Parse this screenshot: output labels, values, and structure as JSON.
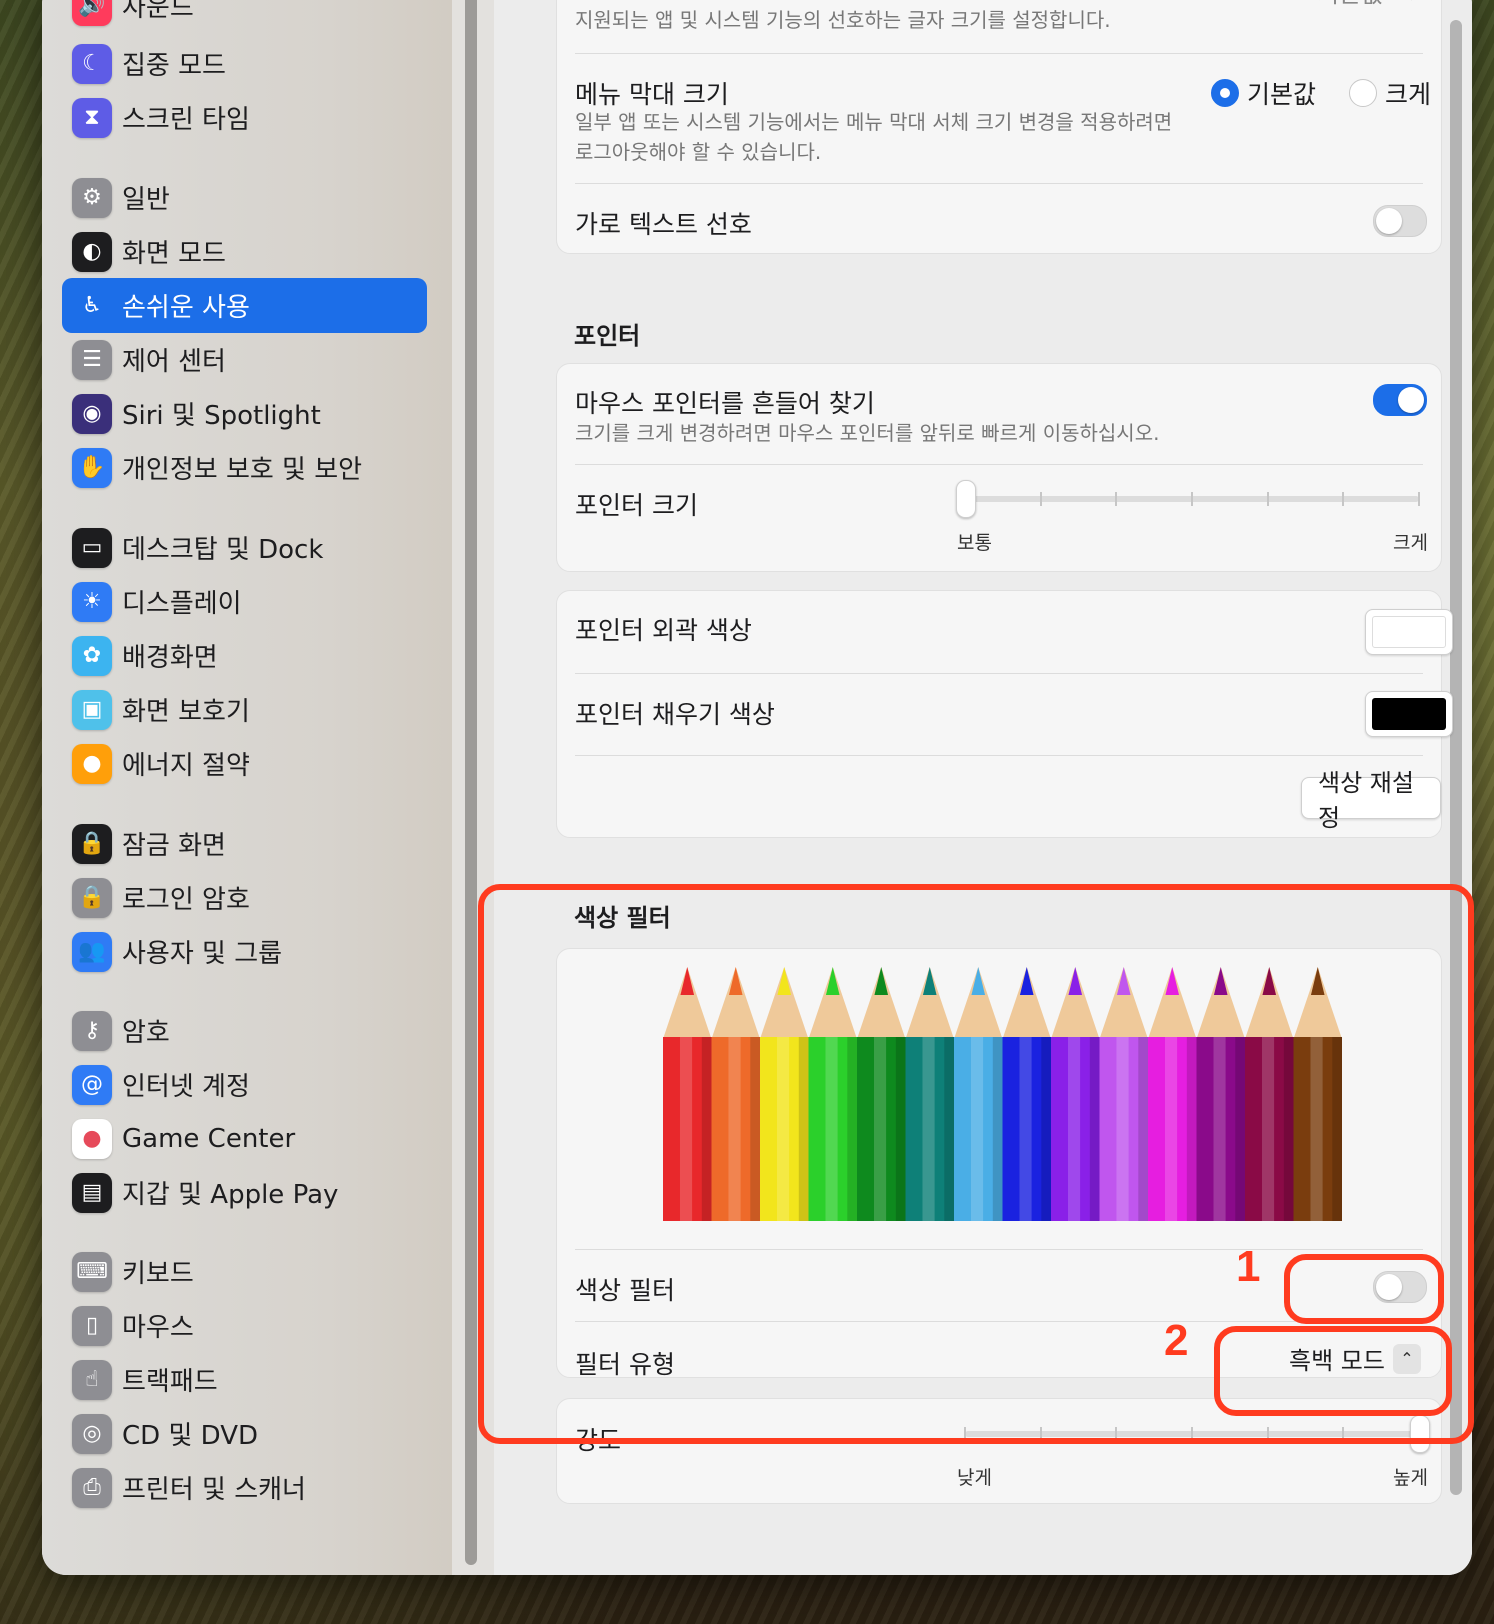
{
  "sidebar": {
    "items": [
      {
        "label": "사운드",
        "icon": "speaker-icon",
        "color": "#ff3b5c"
      },
      {
        "label": "집중 모드",
        "icon": "moon-icon",
        "color": "#5e5ce6"
      },
      {
        "label": "스크린 타임",
        "icon": "hourglass-icon",
        "color": "#5e5ce6"
      },
      {
        "label": "일반",
        "icon": "gear-icon",
        "color": "#8e8e93"
      },
      {
        "label": "화면 모드",
        "icon": "appearance-icon",
        "color": "#1d1d1f"
      },
      {
        "label": "손쉬운 사용",
        "icon": "accessibility-icon",
        "color": "#1c6ee8"
      },
      {
        "label": "제어 센터",
        "icon": "toggles-icon",
        "color": "#8e8e93"
      },
      {
        "label": "Siri 및 Spotlight",
        "icon": "siri-icon",
        "color": "#3a2f7a"
      },
      {
        "label": "개인정보 보호 및 보안",
        "icon": "hand-icon",
        "color": "#2f7bf5"
      },
      {
        "label": "데스크탑 및 Dock",
        "icon": "dock-icon",
        "color": "#1d1d1f"
      },
      {
        "label": "디스플레이",
        "icon": "brightness-icon",
        "color": "#2f7bf5"
      },
      {
        "label": "배경화면",
        "icon": "flower-icon",
        "color": "#3cb4f0"
      },
      {
        "label": "화면 보호기",
        "icon": "screensaver-icon",
        "color": "#4fc1ea"
      },
      {
        "label": "에너지 절약",
        "icon": "bulb-icon",
        "color": "#ff9f0a"
      },
      {
        "label": "잠금 화면",
        "icon": "lock-screen-icon",
        "color": "#1d1d1f"
      },
      {
        "label": "로그인 암호",
        "icon": "lock-icon",
        "color": "#8e8e93"
      },
      {
        "label": "사용자 및 그룹",
        "icon": "users-icon",
        "color": "#2f7bf5"
      },
      {
        "label": "암호",
        "icon": "key-icon",
        "color": "#8e8e93"
      },
      {
        "label": "인터넷 계정",
        "icon": "at-icon",
        "color": "#2f7bf5"
      },
      {
        "label": "Game Center",
        "icon": "game-center-icon",
        "color": "#ffffff"
      },
      {
        "label": "지갑 및 Apple Pay",
        "icon": "wallet-icon",
        "color": "#1d1d1f"
      },
      {
        "label": "키보드",
        "icon": "keyboard-icon",
        "color": "#8e8e93"
      },
      {
        "label": "마우스",
        "icon": "mouse-icon",
        "color": "#8e8e93"
      },
      {
        "label": "트랙패드",
        "icon": "trackpad-icon",
        "color": "#8e8e93"
      },
      {
        "label": "CD 및 DVD",
        "icon": "disc-icon",
        "color": "#8e8e93"
      },
      {
        "label": "프린터 및 스캐너",
        "icon": "printer-icon",
        "color": "#8e8e93"
      }
    ],
    "active_index": 5
  },
  "display": {
    "text_size_sub": "지원되는 앱 및 시스템 기능의 선호하는 글자 크기를 설정합니다.",
    "text_size_value": "기본값",
    "menubar_title": "메뉴 막대 크기",
    "menubar_sub1": "일부 앱 또는 시스템 기능에서는 메뉴 막대 서체 크기 변경을 적용하려면",
    "menubar_sub2": "로그아웃해야 할 수 있습니다.",
    "radio_default": "기본값",
    "radio_large": "크게",
    "horizontal_text": "가로 텍스트 선호"
  },
  "pointer": {
    "section_title": "포인터",
    "shake_title": "마우스 포인터를 흔들어 찾기",
    "shake_sub": "크기를 크게 변경하려면 마우스 포인터를 앞뒤로 빠르게 이동하십시오.",
    "shake_on": true,
    "size_title": "포인터 크기",
    "size_min": "보통",
    "size_max": "크게",
    "size_value": 0,
    "outline_title": "포인터 외곽 색상",
    "outline_color": "#ffffff",
    "fill_title": "포인터 채우기 색상",
    "fill_color": "#000000",
    "reset_label": "색상 재설정"
  },
  "color_filter": {
    "section_title": "색상 필터",
    "pencil_colors": [
      "#e8282b",
      "#ee6a2a",
      "#f2e51c",
      "#2bd02b",
      "#0e8a1e",
      "#0e8078",
      "#4aaee6",
      "#1a22e0",
      "#8a20e8",
      "#c056ee",
      "#e61ee0",
      "#8a0a8a",
      "#8a0a46",
      "#7a3d0e"
    ],
    "toggle_title": "색상 필터",
    "toggle_on": false,
    "type_title": "필터 유형",
    "type_value": "흑백 모드",
    "intensity_title": "강도",
    "intensity_min": "낮게",
    "intensity_max": "높게",
    "intensity_value": 1
  },
  "annotations": {
    "num1": "1",
    "num2": "2",
    "color": "#ff3b1f"
  }
}
